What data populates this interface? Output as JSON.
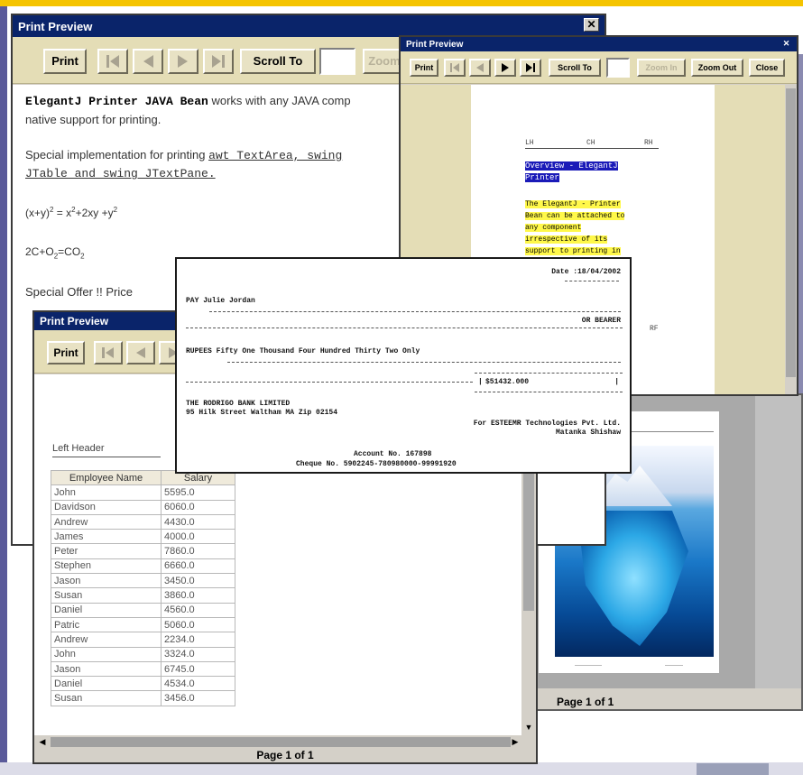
{
  "windowA": {
    "title": "Print Preview",
    "toolbar": {
      "print": "Print",
      "scroll_to": "Scroll To",
      "zoom": "Zoom"
    },
    "doc": {
      "l1_bold": "ElegantJ Printer JAVA Bean",
      "l1_rest": " works with any JAVA comp",
      "l2": "native support for printing.",
      "l3": "Special implementation for printing ",
      "l3_code": "awt TextArea, swing",
      "l4_code": "JTable and swing JTextPane.",
      "eq1": "(x+y)",
      "eq1_sup": "2",
      "eq1_rest": " = x",
      "eq1_sup2": "2",
      "eq1_rest2": "+2xy +y",
      "eq1_sup3": "2",
      "eq2_a": "2C+O",
      "eq2_sub": "2",
      "eq2_b": "=CO",
      "eq2_sub2": "2",
      "offer": "Special Offer !! Price "
    }
  },
  "windowB": {
    "title": "Print Preview",
    "toolbar": {
      "print": "Print",
      "scroll_to": "Scroll To",
      "zoom_in": "Zoom In",
      "zoom_out": "Zoom Out",
      "close": "Close"
    },
    "doc": {
      "lh": "LH",
      "ch": "CH",
      "rh": "RH",
      "overview1": "Overview - ElegantJ",
      "overview2": "Printer",
      "p1": "The ElegantJ - Printer",
      "p2": "Bean can be attached to",
      "p3": "any component",
      "p4": "irrespective of its",
      "p5": "support to printing in",
      "rf": "RF"
    }
  },
  "windowC": {
    "title": "Print Preview",
    "toolbar": {
      "print": "Print"
    },
    "left_header": "Left Header",
    "columns": [
      "Employee Name",
      "Salary"
    ],
    "rows": [
      [
        "John",
        "5595.0"
      ],
      [
        "Davidson",
        "6060.0"
      ],
      [
        "Andrew",
        "4430.0"
      ],
      [
        "James",
        "4000.0"
      ],
      [
        "Peter",
        "7860.0"
      ],
      [
        "Stephen",
        "6660.0"
      ],
      [
        "Jason",
        "3450.0"
      ],
      [
        "Susan",
        "3860.0"
      ],
      [
        "Daniel",
        "4560.0"
      ],
      [
        "Patric",
        "5060.0"
      ],
      [
        "Andrew",
        "2234.0"
      ],
      [
        "John",
        "3324.0"
      ],
      [
        "Jason",
        "6745.0"
      ],
      [
        "Daniel",
        "4534.0"
      ],
      [
        "Susan",
        "3456.0"
      ]
    ],
    "status": "Page 1 of 1"
  },
  "windowD": {
    "status": "Page 1 of 1"
  },
  "cheque": {
    "date": "Date :18/04/2002",
    "pay": "PAY Julie Jordan",
    "bearer": "OR BEARER",
    "rupees": "RUPEES Fifty One Thousand Four Hundred Thirty Two Only",
    "amount": "$51432.000",
    "bank1": "THE RODRIGO BANK LIMITED",
    "bank2": "95 Hilk Street Waltham MA Zip 02154",
    "for1": "For ESTEEMR Technologies Pvt. Ltd.",
    "for2": "Matanka Shishaw",
    "acct": "Account No. 167898",
    "chq": "Cheque No. 5902245-780980000-99991920"
  },
  "colors": {
    "accent_yellow": "#f5c400",
    "title_blue": "#0a246a",
    "highlight_blue": "#1a1ab8",
    "highlight_yellow": "#fff84a"
  }
}
